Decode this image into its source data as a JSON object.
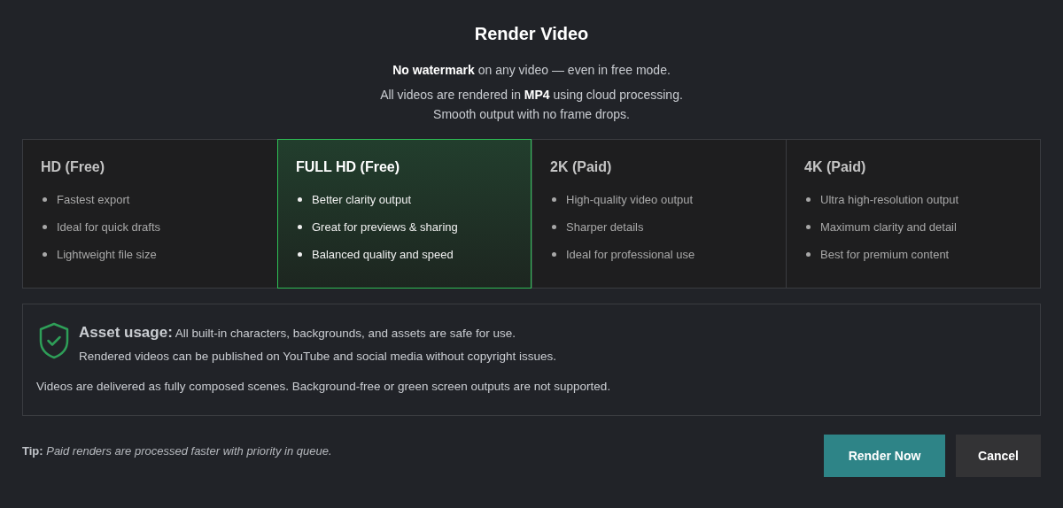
{
  "dialog": {
    "title": "Render Video",
    "intro": [
      "**No watermark** on any video — even in free mode.",
      "All videos are rendered in **MP4** using cloud processing.",
      "Smooth output with no frame drops."
    ],
    "options": [
      {
        "title": "HD (Free)",
        "selected": false,
        "features": [
          "Fastest export",
          "Ideal for quick drafts",
          "Lightweight file size"
        ]
      },
      {
        "title": "FULL HD (Free)",
        "selected": true,
        "features": [
          "Better clarity output",
          "Great for previews & sharing",
          "Balanced quality and speed"
        ]
      },
      {
        "title": "2K (Paid)",
        "selected": false,
        "features": [
          "High-quality video output",
          "Sharper details",
          "Ideal for professional use"
        ]
      },
      {
        "title": "4K (Paid)",
        "selected": false,
        "features": [
          "Ultra high-resolution output",
          "Maximum clarity and detail",
          "Best for premium content"
        ]
      }
    ],
    "asset_notice": {
      "lines": [
        "**Asset usage:** All built-in characters, backgrounds, and assets are safe for use.",
        "Rendered videos can be published on YouTube and social media without copyright issues."
      ],
      "note": "Videos are delivered as fully composed scenes. Background-free or green screen outputs are not supported."
    },
    "tip": "**Tip:** *Paid renders are processed faster with priority in queue.*",
    "buttons": [
      {
        "label": "Render Now",
        "kind": "primary"
      },
      {
        "label": "Cancel",
        "kind": "secondary"
      }
    ]
  }
}
